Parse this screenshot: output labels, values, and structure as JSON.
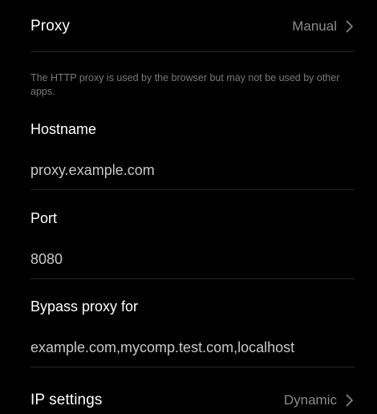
{
  "proxy_row": {
    "title": "Proxy",
    "value": "Manual"
  },
  "hint": "The HTTP proxy is used by the browser but may not be used by other apps.",
  "hostname": {
    "label": "Hostname",
    "value": "proxy.example.com"
  },
  "port": {
    "label": "Port",
    "value": "8080"
  },
  "bypass": {
    "label": "Bypass proxy for",
    "value": "example.com,mycomp.test.com,localhost"
  },
  "ip_settings_row": {
    "title": "IP settings",
    "value": "Dynamic"
  },
  "icons": {
    "proxy_chevron": "chevron-right-icon",
    "ip_chevron": "chevron-right-icon"
  }
}
